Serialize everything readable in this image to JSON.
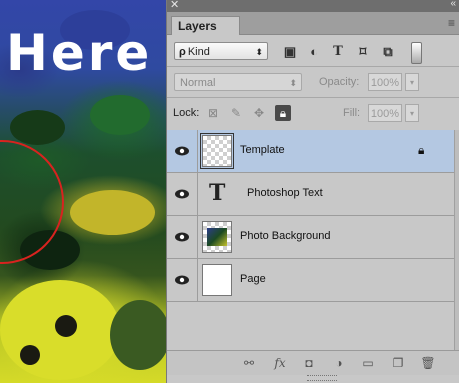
{
  "canvas": {
    "overlay_text": "Here"
  },
  "panel": {
    "close_icon": "close-icon",
    "collapse_icon": "collapse-arrows-icon",
    "tab_label": "Layers",
    "menu_icon": "panel-menu-icon"
  },
  "filter": {
    "kind_value": "Kind",
    "icons": [
      "pixel-filter-icon",
      "adjustment-filter-icon",
      "type-filter-icon",
      "shape-filter-icon",
      "smart-object-filter-icon"
    ]
  },
  "blend": {
    "mode": "Normal",
    "opacity_label": "Opacity:",
    "opacity_value": "100%"
  },
  "lock": {
    "label": "Lock:",
    "fill_label": "Fill:",
    "fill_value": "100%"
  },
  "layers": [
    {
      "name": "Template",
      "selected": true,
      "locked": true,
      "thumb": "transparent"
    },
    {
      "name": "Photoshop Text",
      "selected": false,
      "locked": false,
      "thumb": "type"
    },
    {
      "name": "Photo Background",
      "selected": false,
      "locked": false,
      "thumb": "photo"
    },
    {
      "name": "Page",
      "selected": false,
      "locked": false,
      "thumb": "white"
    }
  ],
  "bottom_icons": [
    "link-layers-icon",
    "fx-icon",
    "add-mask-icon",
    "adjustment-layer-icon",
    "new-group-icon",
    "new-layer-icon",
    "trash-icon"
  ],
  "colors": {
    "selected_row": "#b4c8e2",
    "panel_bg": "#c8c8c8",
    "annotation_circle": "#d8231f"
  }
}
